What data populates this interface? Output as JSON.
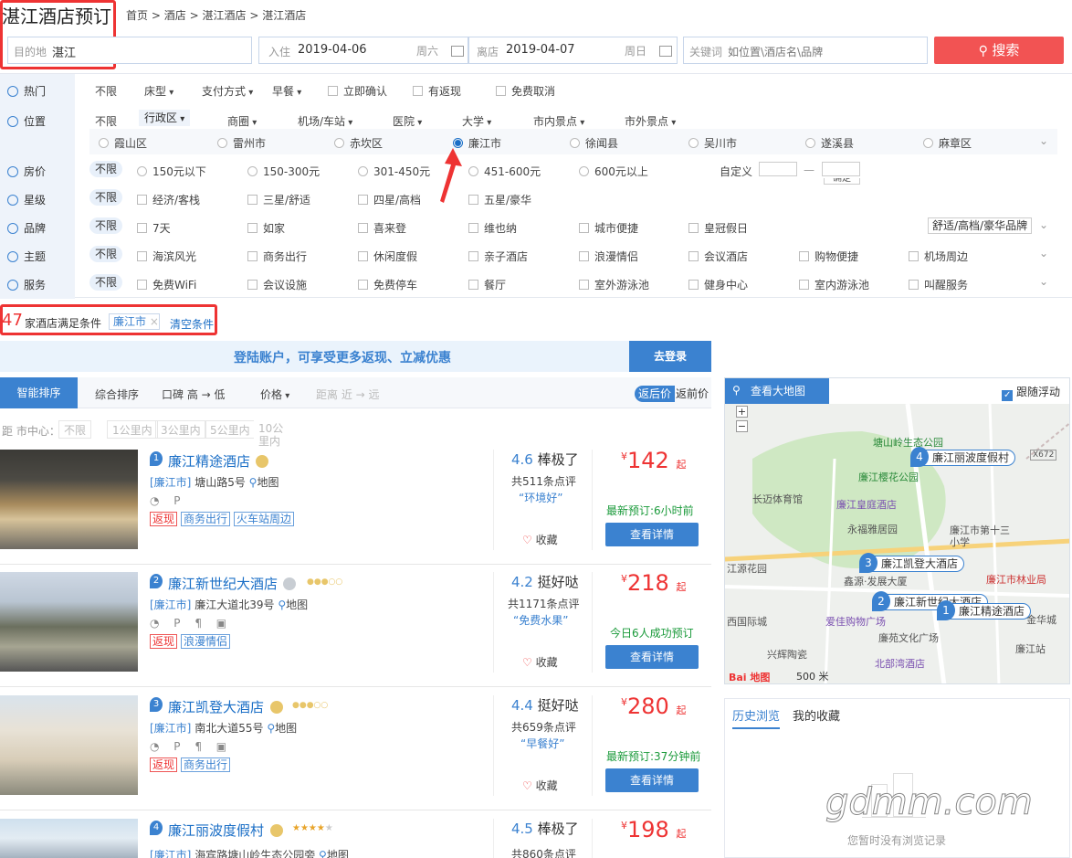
{
  "page": {
    "title": "湛江酒店预订"
  },
  "breadcrumb": [
    "首页",
    ">",
    "酒店",
    ">",
    "湛江酒店",
    ">",
    "湛江酒店"
  ],
  "search": {
    "dest_label": "目的地",
    "dest_value": "湛江",
    "checkin_label": "入住",
    "checkin_value": "2019-04-06",
    "checkin_week": "周六",
    "checkout_label": "离店",
    "checkout_value": "2019-04-07",
    "checkout_week": "周日",
    "keyword_label": "关键词",
    "keyword_placeholder": "如位置\\酒店名\\品牌",
    "search_label": "搜索"
  },
  "filters": {
    "hot": {
      "name": "热门",
      "all": "不限",
      "items": [
        "床型",
        "支付方式",
        "早餐",
        "立即确认",
        "有返现",
        "免费取消"
      ]
    },
    "location": {
      "name": "位置",
      "all": "不限",
      "tabs": [
        "行政区",
        "商圈",
        "机场/车站",
        "医院",
        "大学",
        "市内景点",
        "市外景点"
      ],
      "districts": [
        "霞山区",
        "雷州市",
        "赤坎区",
        "廉江市",
        "徐闻县",
        "吴川市",
        "遂溪县",
        "麻章区"
      ]
    },
    "price": {
      "name": "房价",
      "all": "不限",
      "items": [
        "150元以下",
        "150-300元",
        "301-450元",
        "451-600元",
        "600元以上"
      ],
      "custom": "自定义",
      "dash": "—",
      "ok": "确定"
    },
    "star": {
      "name": "星级",
      "all": "不限",
      "items": [
        "经济/客栈",
        "三星/舒适",
        "四星/高档",
        "五星/豪华"
      ]
    },
    "brand": {
      "name": "品牌",
      "all": "不限",
      "items": [
        "7天",
        "如家",
        "喜来登",
        "维也纳",
        "城市便捷",
        "皇冠假日"
      ],
      "select": "舒适/高档/豪华品牌"
    },
    "theme": {
      "name": "主题",
      "all": "不限",
      "items": [
        "海滨风光",
        "商务出行",
        "休闲度假",
        "亲子酒店",
        "浪漫情侣",
        "会议酒店",
        "购物便捷",
        "机场周边"
      ]
    },
    "service": {
      "name": "服务",
      "all": "不限",
      "items": [
        "免费WiFi",
        "会议设施",
        "免费停车",
        "餐厅",
        "室外游泳池",
        "健身中心",
        "室内游泳池",
        "叫醒服务"
      ]
    }
  },
  "result": {
    "count": "47",
    "text": "家酒店满足条件",
    "chip": "廉江市",
    "chip_x": "×",
    "clear": "清空条件"
  },
  "banner": {
    "text": "登陆账户，可享受更多返现、立减优惠",
    "button": "去登录"
  },
  "sort": {
    "items": [
      "智能排序",
      "综合排序",
      "口碑 高 → 低",
      "价格",
      "距离 近 → 远"
    ],
    "after": "返后价",
    "before": "返前价"
  },
  "distance": {
    "label": "距 市中心：",
    "items": [
      "不限",
      "1公里内",
      "3公里内",
      "5公里内",
      "10公里内"
    ]
  },
  "hotels": [
    {
      "num": "1",
      "name": "廉江精途酒店",
      "city": "[廉江市]",
      "addr": "塘山路5号",
      "map": "地图",
      "facilities": "◔ P",
      "tags": [
        "返现",
        "商务出行",
        "火车站周边"
      ],
      "score": "4.6",
      "level": "棒极了",
      "reviews": "共511条点评",
      "quote": "“环境好”",
      "fav": "收藏",
      "currency": "¥",
      "price": "142",
      "qi": "起",
      "booked": "最新预订:6小时前",
      "btn": "查看详情"
    },
    {
      "num": "2",
      "name": "廉江新世纪大酒店",
      "city": "[廉江市]",
      "addr": "廉江大道北39号",
      "map": "地图",
      "facilities": "◔ P ¶ ▣",
      "tags": [
        "返现",
        "浪漫情侣"
      ],
      "score": "4.2",
      "level": "挺好哒",
      "reviews": "共1171条点评",
      "quote": "“免费水果”",
      "fav": "收藏",
      "currency": "¥",
      "price": "218",
      "qi": "起",
      "booked": "今日6人成功预订",
      "btn": "查看详情"
    },
    {
      "num": "3",
      "name": "廉江凯登大酒店",
      "city": "[廉江市]",
      "addr": "南北大道55号",
      "map": "地图",
      "facilities": "◔ P ¶ ▣",
      "tags": [
        "返现",
        "商务出行"
      ],
      "score": "4.4",
      "level": "挺好哒",
      "reviews": "共659条点评",
      "quote": "“早餐好”",
      "fav": "收藏",
      "currency": "¥",
      "price": "280",
      "qi": "起",
      "booked": "最新预订:37分钟前",
      "btn": "查看详情"
    },
    {
      "num": "4",
      "name": "廉江丽波度假村",
      "city": "[廉江市]",
      "addr": "海宾路塘山岭生态公园旁",
      "map": "地图",
      "facilities": "",
      "tags": [],
      "score": "4.5",
      "level": "棒极了",
      "reviews": "共860条点评",
      "quote": "",
      "fav": "收藏",
      "currency": "¥",
      "price": "198",
      "qi": "起",
      "booked": "",
      "btn": ""
    }
  ],
  "map": {
    "button": "查看大地图",
    "follow": "跟随浮动",
    "scale": "500 米",
    "logo": "Bai 地图",
    "markers": [
      {
        "n": "4",
        "label": "廉江丽波度假村"
      },
      {
        "n": "3",
        "label": "廉江凯登大酒店"
      },
      {
        "n": "2",
        "label": "廉江新世纪大酒店"
      },
      {
        "n": "1",
        "label": "廉江精途酒店"
      }
    ],
    "pois": [
      "塘山岭生态公园",
      "廉江樱花公园",
      "长迈体育馆",
      "廉江皇庭酒店",
      "永福雅居园",
      "廉江市第十三小学",
      "鑫源·发展大厦",
      "廉江市林业局",
      "爱佳购物广场",
      "廉苑文化广场",
      "兴辉陶瓷",
      "北部湾酒店",
      "廉江站",
      "江源花园",
      "西国际城",
      "金华城",
      "X672"
    ]
  },
  "history": {
    "tab1": "历史浏览",
    "tab2": "我的收藏",
    "empty": "您暂时没有浏览记录",
    "watermark": "gdmm.com"
  },
  "colors": {
    "accent": "#3b82d0",
    "price": "#e33333",
    "search": "#f25353"
  }
}
